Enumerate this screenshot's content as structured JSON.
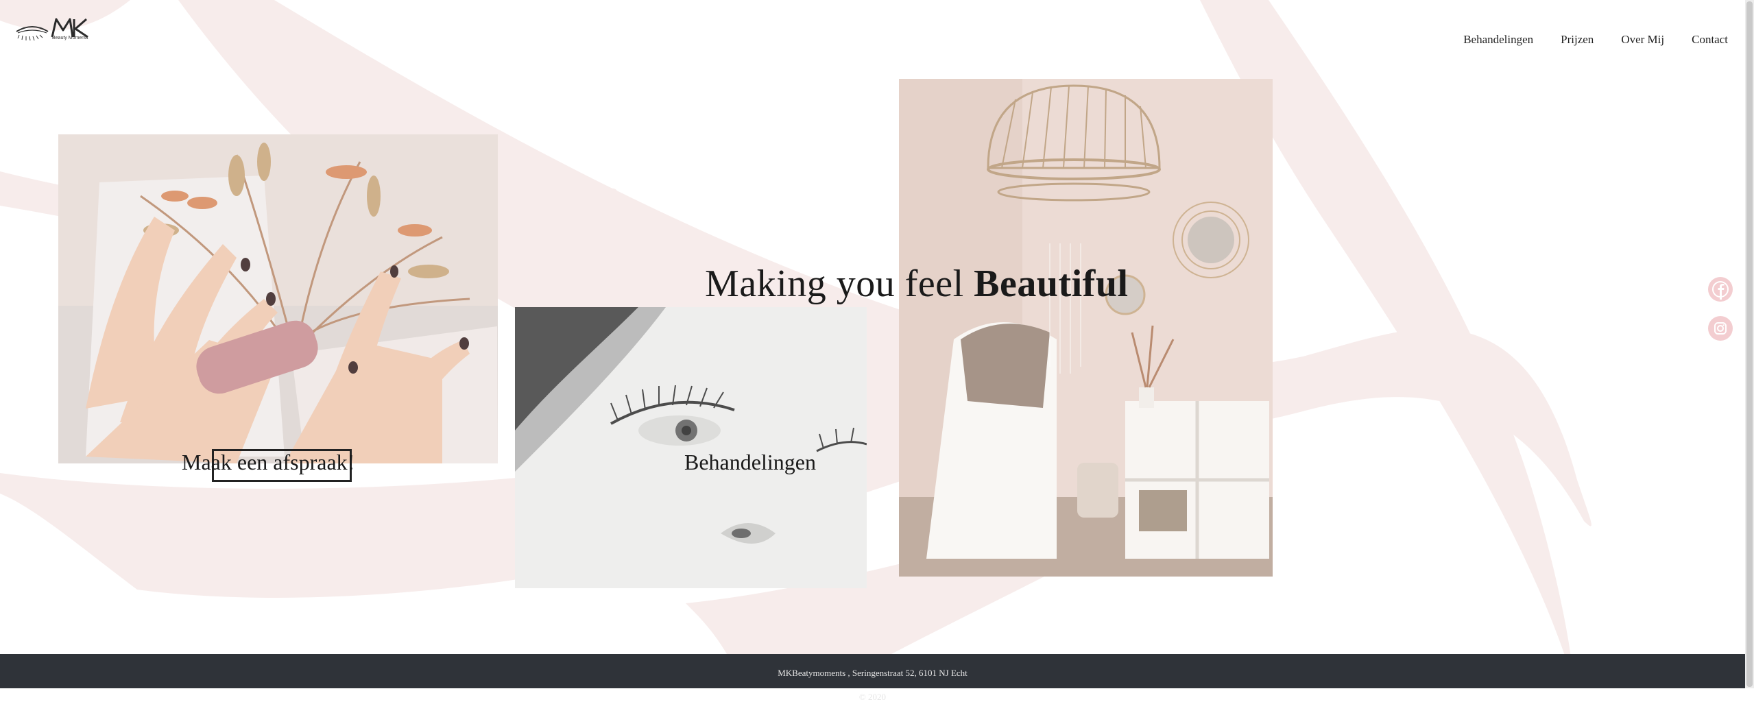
{
  "brand": {
    "logo_text": "MK",
    "logo_subtext": "Beauty Moments"
  },
  "nav": {
    "items": [
      "Behandelingen",
      "Prijzen",
      "Over Mij",
      "Contact"
    ]
  },
  "hero": {
    "title_light": "Making you feel",
    "title_bold": "Beautiful"
  },
  "links": {
    "appointment": "Maak een afspraak!",
    "treatments": "Behandelingen"
  },
  "footer": {
    "address": "MKBeatymoments , Seringenstraat 52, 6101 NJ Echt",
    "copyright": "© 2020"
  },
  "social": {
    "facebook": "facebook-icon",
    "instagram": "instagram-icon"
  },
  "colors": {
    "accent_pink": "#f3cdd0",
    "background_swoosh": "#f7eceb",
    "footer_bg": "#2f3339",
    "text": "#1f1f1f"
  }
}
